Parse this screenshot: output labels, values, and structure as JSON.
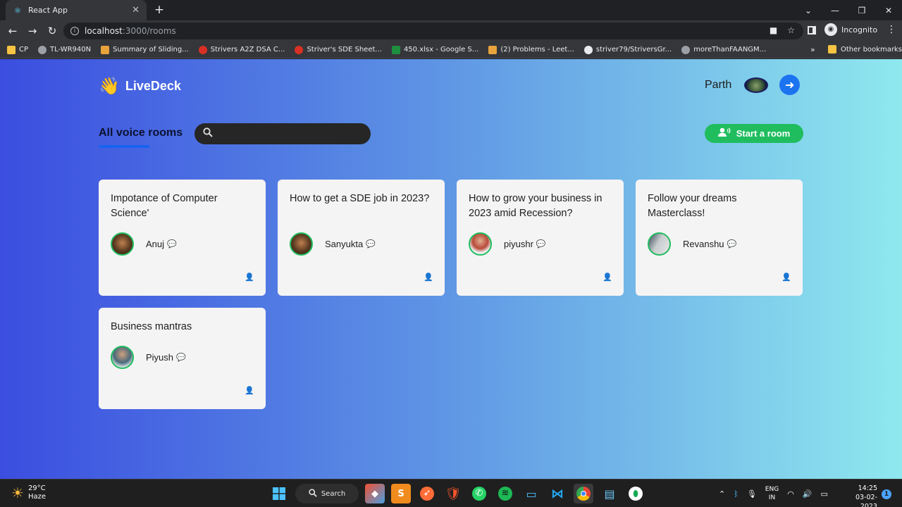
{
  "browser": {
    "tab": {
      "title": "React App"
    },
    "address": {
      "host": "localhost",
      "path": ":3000/rooms"
    },
    "profile": "Incognito",
    "bookmarks": [
      {
        "label": "CP",
        "color": "#f6c342"
      },
      {
        "label": "TL-WR940N",
        "color": "#9aa0a6"
      },
      {
        "label": "Summary of Sliding...",
        "color": "#e8a33d"
      },
      {
        "label": "Strivers A2Z DSA C...",
        "color": "#d93025"
      },
      {
        "label": "Striver's SDE Sheet...",
        "color": "#d93025"
      },
      {
        "label": "450.xlsx - Google S...",
        "color": "#1e8e3e"
      },
      {
        "label": "(2) Problems - Leet...",
        "color": "#e8a33d"
      },
      {
        "label": "striver79/StriversGr...",
        "color": "#e8eaed"
      },
      {
        "label": "moreThanFAANGM...",
        "color": "#9aa0a6"
      }
    ],
    "more_bookmarks": "»",
    "other_bookmarks": "Other bookmarks"
  },
  "app": {
    "brand": "LiveDeck",
    "user": {
      "name": "Parth"
    },
    "heading": "All voice rooms",
    "search": {
      "value": "",
      "placeholder": ""
    },
    "start_room_label": "Start a room",
    "rooms": [
      {
        "topic": "Impotance of Computer Science'",
        "speaker": "Anuj",
        "avatar_color": "#6b4a2a"
      },
      {
        "topic": "How to get a SDE job in 2023?",
        "speaker": "Sanyukta",
        "avatar_color": "#6b4a2a"
      },
      {
        "topic": "How to grow your business in 2023 amid Recession?",
        "speaker": "piyushr",
        "avatar_color": "#b84a3a"
      },
      {
        "topic": "Follow your dreams Masterclass!",
        "speaker": "Revanshu",
        "avatar_color": "#9aa3a8"
      },
      {
        "topic": "Business mantras",
        "speaker": "Piyush",
        "avatar_color": "#4a6a7a"
      }
    ]
  },
  "taskbar": {
    "weather": {
      "temp": "29°C",
      "condition": "Haze"
    },
    "search_label": "Search",
    "lang": {
      "line1": "ENG",
      "line2": "IN"
    },
    "time": "14:25",
    "date": "03-02-2023",
    "notifications": "1"
  }
}
